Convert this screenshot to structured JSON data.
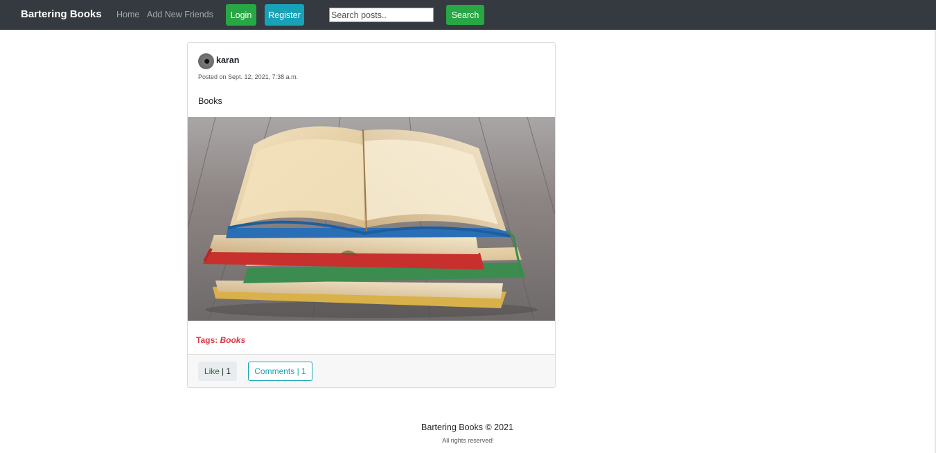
{
  "navbar": {
    "brand": "Bartering Books",
    "links": [
      "Home",
      "Add New Friends"
    ],
    "login_label": "Login",
    "register_label": "Register",
    "search_placeholder": "Search posts..",
    "search_button_label": "Search"
  },
  "post": {
    "author": "karan",
    "posted_on": "Posted on Sept. 12, 2021, 7:38 a.m.",
    "content": "Books",
    "tags_label": "Tags:",
    "tag": "Books",
    "like_label": "Like",
    "like_count": "| 1",
    "comments_label": "Comments | 1"
  },
  "footer": {
    "title": "Bartering Books © 2021",
    "subtitle": "All rights reserved!"
  },
  "colors": {
    "navbar": "#343a40",
    "success": "#28a745",
    "info": "#17a2b8",
    "danger": "#dc3545"
  },
  "icons": [
    "avatar-image"
  ]
}
